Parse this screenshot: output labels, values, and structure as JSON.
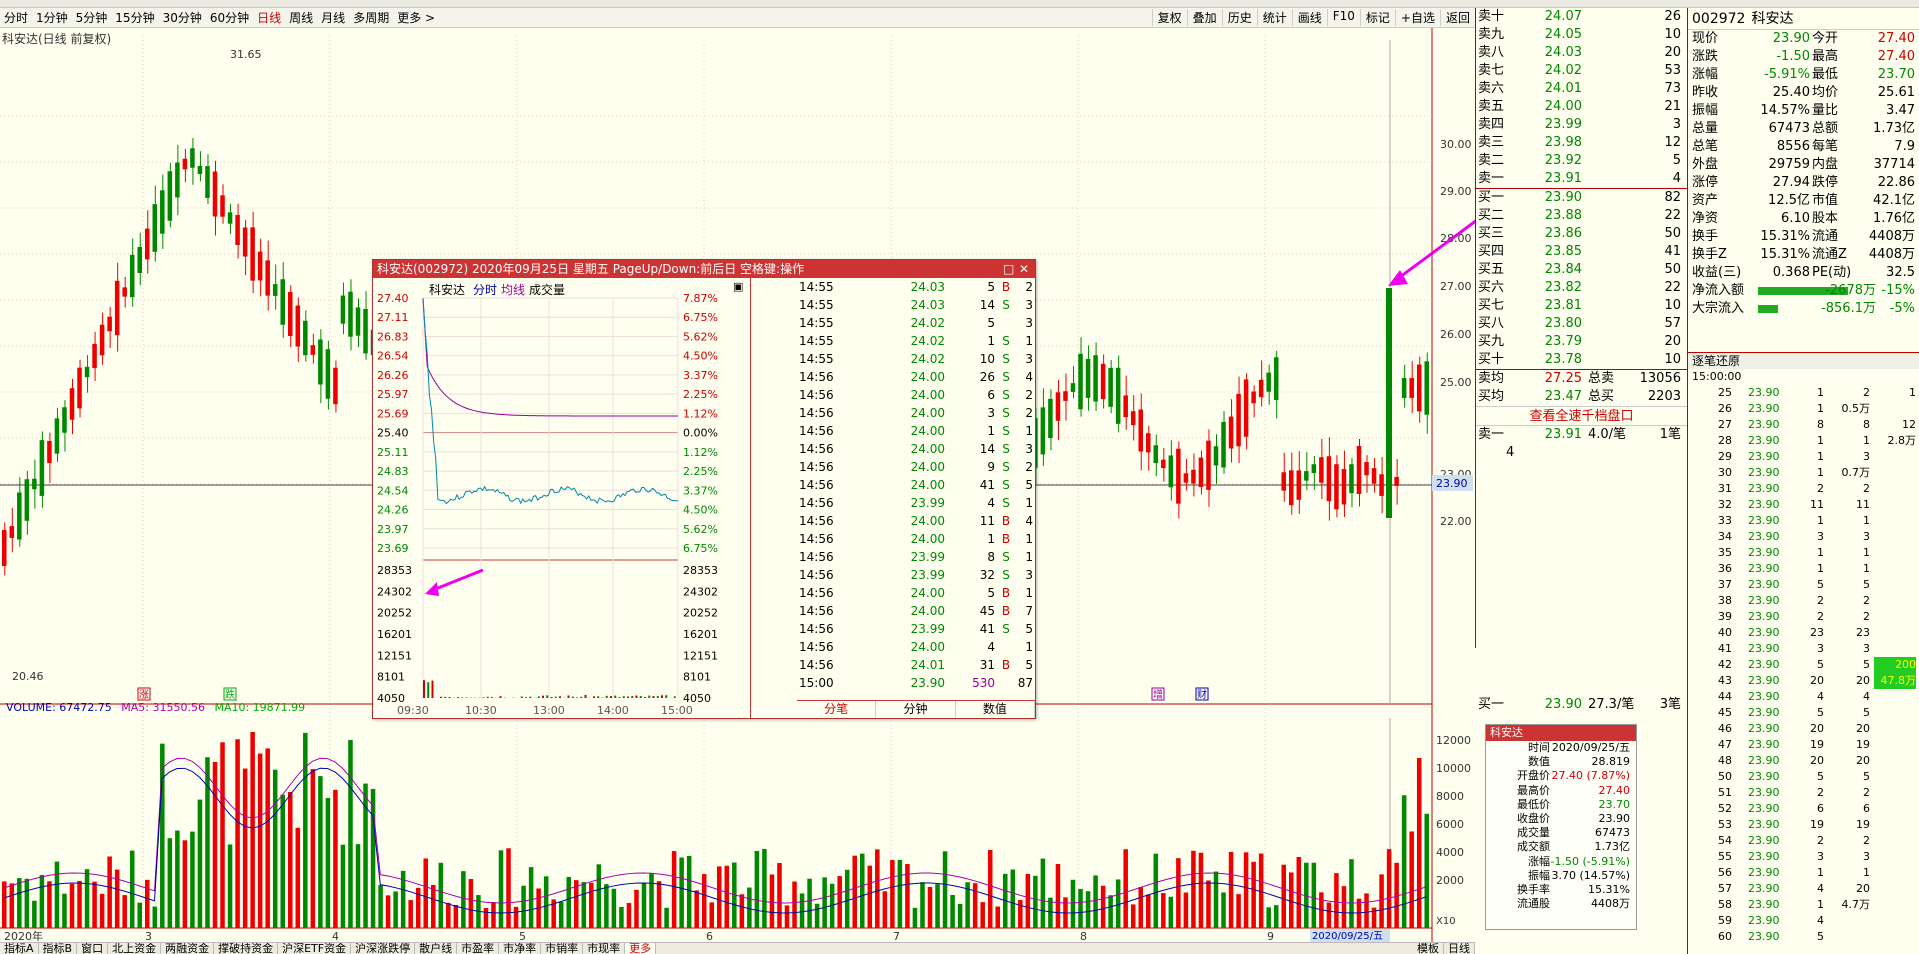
{
  "toolbar": {
    "items": [
      "分时",
      "1分钟",
      "5分钟",
      "15分钟",
      "30分钟",
      "60分钟",
      "日线",
      "周线",
      "月线",
      "多周期",
      "更多 >"
    ],
    "active": 6,
    "right": [
      "复权",
      "叠加",
      "历史",
      "统计",
      "画线",
      "F10",
      "标记",
      "+自选",
      "返回"
    ]
  },
  "chart": {
    "title": "科安达(日线 前复权)",
    "high_label": "31.65",
    "low_label": "20.46",
    "price_ticks": [
      "30.00",
      "29.00",
      "28.00",
      "27.00",
      "26.00",
      "25.00",
      "23.00",
      "22.00"
    ],
    "cur_price_tag": "23.90",
    "vol_ticks": [
      "12000",
      "10000",
      "8000",
      "6000",
      "4000",
      "2000"
    ],
    "vol_unit": "X10",
    "vol_legend": {
      "vol": "VOLUME: 67472.75",
      "ma5": "MA5: 31550.56",
      "ma10": "MA10: 19871.99"
    },
    "vol_colors": {
      "vol": "#00a",
      "ma5": "#a0a",
      "ma10": "#0a0"
    },
    "dates": [
      "2020年",
      "3",
      "4",
      "5",
      "6",
      "7",
      "8",
      "9"
    ],
    "sel_date": "2020/09/25/五",
    "events": [
      "涨",
      "跌",
      "增",
      "财"
    ]
  },
  "popup": {
    "title": "科安达(002972) 2020年09月25日 星期五 PageUp/Down:前后日 空格键:操作",
    "name": "科安达",
    "mode_labels": [
      "分时",
      "均线",
      "成交量"
    ],
    "left_prices": [
      "27.40",
      "27.11",
      "26.83",
      "26.54",
      "26.26",
      "25.97",
      "25.69",
      "25.40",
      "25.11",
      "24.83",
      "24.54",
      "24.26",
      "23.97",
      "23.69"
    ],
    "right_pcts": [
      "7.87%",
      "6.75%",
      "5.62%",
      "4.50%",
      "3.37%",
      "2.25%",
      "1.12%",
      "0.00%",
      "1.12%",
      "2.25%",
      "3.37%",
      "4.50%",
      "5.62%",
      "6.75%"
    ],
    "vol_levels": [
      "28353",
      "24302",
      "20252",
      "16201",
      "12151",
      "8101",
      "4050"
    ],
    "times": [
      "09:30",
      "10:30",
      "13:00",
      "14:00",
      "15:00"
    ],
    "ticks": [
      [
        "14:55",
        "24.03",
        "5",
        "B",
        "2"
      ],
      [
        "14:55",
        "24.03",
        "14",
        "S",
        "3"
      ],
      [
        "14:55",
        "24.02",
        "5",
        "",
        "3"
      ],
      [
        "14:55",
        "24.02",
        "1",
        "S",
        "1"
      ],
      [
        "14:55",
        "24.02",
        "10",
        "S",
        "3"
      ],
      [
        "14:56",
        "24.00",
        "26",
        "S",
        "4"
      ],
      [
        "14:56",
        "24.00",
        "6",
        "S",
        "2"
      ],
      [
        "14:56",
        "24.00",
        "3",
        "S",
        "2"
      ],
      [
        "14:56",
        "24.00",
        "1",
        "S",
        "1"
      ],
      [
        "14:56",
        "24.00",
        "14",
        "S",
        "3"
      ],
      [
        "14:56",
        "24.00",
        "9",
        "S",
        "2"
      ],
      [
        "14:56",
        "24.00",
        "41",
        "S",
        "5"
      ],
      [
        "14:56",
        "23.99",
        "4",
        "S",
        "1"
      ],
      [
        "14:56",
        "24.00",
        "11",
        "B",
        "4"
      ],
      [
        "14:56",
        "24.00",
        "1",
        "B",
        "1"
      ],
      [
        "14:56",
        "23.99",
        "8",
        "S",
        "1"
      ],
      [
        "14:56",
        "23.99",
        "32",
        "S",
        "3"
      ],
      [
        "14:56",
        "24.00",
        "5",
        "B",
        "1"
      ],
      [
        "14:56",
        "24.00",
        "45",
        "B",
        "7"
      ],
      [
        "14:56",
        "23.99",
        "41",
        "S",
        "5"
      ],
      [
        "14:56",
        "24.00",
        "4",
        "",
        "1"
      ],
      [
        "14:56",
        "24.01",
        "31",
        "B",
        "5"
      ],
      [
        "15:00",
        "23.90",
        "530",
        "",
        "87"
      ]
    ],
    "tabs": [
      "分笔",
      "分钟",
      "数值"
    ]
  },
  "orderbook": {
    "sell": [
      [
        "卖十",
        "24.07",
        "26"
      ],
      [
        "卖九",
        "24.05",
        "10"
      ],
      [
        "卖八",
        "24.03",
        "20"
      ],
      [
        "卖七",
        "24.02",
        "53"
      ],
      [
        "卖六",
        "24.01",
        "73"
      ],
      [
        "卖五",
        "24.00",
        "21"
      ],
      [
        "卖四",
        "23.99",
        "3"
      ],
      [
        "卖三",
        "23.98",
        "12"
      ],
      [
        "卖二",
        "23.92",
        "5"
      ],
      [
        "卖一",
        "23.91",
        "4"
      ]
    ],
    "buy": [
      [
        "买一",
        "23.90",
        "82"
      ],
      [
        "买二",
        "23.88",
        "22"
      ],
      [
        "买三",
        "23.86",
        "50"
      ],
      [
        "买四",
        "23.85",
        "41"
      ],
      [
        "买五",
        "23.84",
        "50"
      ],
      [
        "买六",
        "23.82",
        "22"
      ],
      [
        "买七",
        "23.81",
        "10"
      ],
      [
        "买八",
        "23.80",
        "57"
      ],
      [
        "买九",
        "23.79",
        "20"
      ],
      [
        "买十",
        "23.78",
        "10"
      ]
    ],
    "avg_sell": "27.25",
    "avg_buy": "23.47",
    "total_sell": "13056",
    "total_buy": "2203",
    "avg_sell_lbl": "卖均",
    "avg_buy_lbl": "买均",
    "ts_lbl": "总卖",
    "tb_lbl": "总买",
    "link": "查看全速千档盘口",
    "s1": [
      "卖一",
      "23.91",
      "4.0/笔",
      "1笔"
    ],
    "s1q": "4",
    "b1": [
      "买一",
      "23.90",
      "27.3/笔",
      "3笔"
    ]
  },
  "quote": {
    "code": "002972",
    "name": "科安达",
    "rows": [
      [
        "现价",
        "23.90",
        "今开",
        "27.40"
      ],
      [
        "涨跌",
        "-1.50",
        "最高",
        "27.40"
      ],
      [
        "涨幅",
        "-5.91%",
        "最低",
        "23.70"
      ],
      [
        "昨收",
        "25.40",
        "均价",
        "25.61"
      ],
      [
        "振幅",
        "14.57%",
        "量比",
        "3.47"
      ],
      [
        "总量",
        "67473",
        "总额",
        "1.73亿"
      ],
      [
        "总笔",
        "8556",
        "每笔",
        "7.9"
      ],
      [
        "外盘",
        "29759",
        "内盘",
        "37714"
      ],
      [
        "涨停",
        "27.94",
        "跌停",
        "22.86"
      ],
      [
        "资产",
        "12.5亿",
        "市值",
        "42.1亿"
      ],
      [
        "净资",
        "6.10",
        "股本",
        "1.76亿"
      ],
      [
        "换手",
        "15.31%",
        "流通",
        "4408万"
      ],
      [
        "换手Z",
        "15.31%",
        "流通Z",
        "4408万"
      ],
      [
        "收益(三)",
        "0.368",
        "PE(动)",
        "32.5"
      ]
    ],
    "flow": [
      [
        "净流入额",
        "-2678万",
        "-15%"
      ],
      [
        "大宗流入",
        "-856.1万",
        "-5%"
      ]
    ]
  },
  "ticklist": {
    "title": "逐笔还原",
    "first_time": "15:00:00",
    "rows": [
      [
        "25",
        "23.90",
        "1",
        "2",
        "1"
      ],
      [
        "26",
        "23.90",
        "1",
        "0.5万",
        ""
      ],
      [
        "27",
        "23.90",
        "8",
        "8",
        "12"
      ],
      [
        "28",
        "23.90",
        "1",
        "1",
        "2.8万"
      ],
      [
        "29",
        "23.90",
        "1",
        "3",
        ""
      ],
      [
        "30",
        "23.90",
        "1",
        "0.7万",
        ""
      ],
      [
        "31",
        "23.90",
        "2",
        "2",
        ""
      ],
      [
        "32",
        "23.90",
        "11",
        "11",
        ""
      ],
      [
        "33",
        "23.90",
        "1",
        "1",
        ""
      ],
      [
        "34",
        "23.90",
        "3",
        "3",
        ""
      ],
      [
        "35",
        "23.90",
        "1",
        "1",
        ""
      ],
      [
        "36",
        "23.90",
        "1",
        "1",
        ""
      ],
      [
        "37",
        "23.90",
        "5",
        "5",
        ""
      ],
      [
        "38",
        "23.90",
        "2",
        "2",
        ""
      ],
      [
        "39",
        "23.90",
        "2",
        "2",
        ""
      ],
      [
        "40",
        "23.90",
        "23",
        "23",
        ""
      ],
      [
        "41",
        "23.90",
        "3",
        "3",
        ""
      ],
      [
        "42",
        "23.90",
        "5",
        "5",
        "200"
      ],
      [
        "43",
        "23.90",
        "20",
        "20",
        "47.8万"
      ],
      [
        "44",
        "23.90",
        "4",
        "4",
        ""
      ],
      [
        "45",
        "23.90",
        "5",
        "5",
        ""
      ],
      [
        "46",
        "23.90",
        "20",
        "20",
        ""
      ],
      [
        "47",
        "23.90",
        "19",
        "19",
        ""
      ],
      [
        "48",
        "23.90",
        "20",
        "20",
        ""
      ],
      [
        "50",
        "23.90",
        "5",
        "5",
        ""
      ],
      [
        "51",
        "23.90",
        "2",
        "2",
        ""
      ],
      [
        "52",
        "23.90",
        "6",
        "6",
        ""
      ],
      [
        "53",
        "23.90",
        "19",
        "19",
        ""
      ],
      [
        "54",
        "23.90",
        "2",
        "2",
        ""
      ],
      [
        "55",
        "23.90",
        "3",
        "3",
        ""
      ],
      [
        "56",
        "23.90",
        "1",
        "1",
        ""
      ],
      [
        "57",
        "23.90",
        "4",
        "20",
        ""
      ],
      [
        "58",
        "23.90",
        "1",
        "4.7万",
        ""
      ],
      [
        "59",
        "23.90",
        "4",
        "",
        ""
      ],
      [
        "60",
        "23.90",
        "5",
        "",
        ""
      ]
    ]
  },
  "tooltip": {
    "name": "科安达",
    "rows": [
      [
        "时间",
        "2020/09/25/五"
      ],
      [
        "数值",
        "28.819"
      ],
      [
        "开盘价",
        "27.40 (7.87%)"
      ],
      [
        "最高价",
        "27.40"
      ],
      [
        "最低价",
        "23.70"
      ],
      [
        "收盘价",
        "23.90"
      ],
      [
        "成交量",
        "67473"
      ],
      [
        "成交额",
        "1.73亿"
      ],
      [
        "涨幅",
        "-1.50 (-5.91%)"
      ],
      [
        "振幅",
        "3.70 (14.57%)"
      ],
      [
        "换手率",
        "15.31%"
      ],
      [
        "流通股",
        "4408万"
      ]
    ]
  },
  "bottombar": {
    "items": [
      "指标A",
      "指标B",
      "窗口",
      "北上资金",
      "两融资金",
      "撑破持资金",
      "沪深ETF资金",
      "沪深涨跌停",
      "散户线",
      "市盈率",
      "市净率",
      "市销率",
      "市现率",
      "更多"
    ],
    "right_tags": [
      "模板",
      "日线"
    ]
  }
}
